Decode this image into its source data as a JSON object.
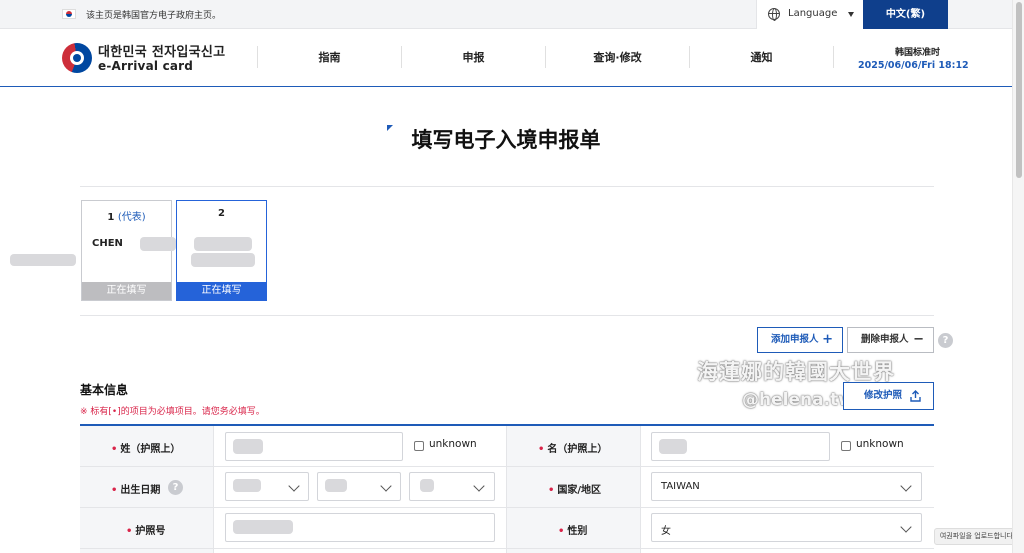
{
  "topbar": {
    "notice": "该主页是韩国官方电子政府主页。",
    "language_label": "Language",
    "current_language": "中文(繁)"
  },
  "header": {
    "logo_kr": "대한민국 전자입국신고",
    "logo_en": "e-Arrival card",
    "nav": [
      "指南",
      "申报",
      "查询·修改",
      "通知"
    ],
    "time_label": "韩国标准时",
    "time_value": "2025/06/06/Fri 18:12"
  },
  "page": {
    "title": "填写电子入境申报单"
  },
  "applicants": [
    {
      "number": "1",
      "rep_label": "(代表)",
      "name": "CHEN",
      "status": "正在填写"
    },
    {
      "number": "2",
      "rep_label": "",
      "name": "",
      "status": "正在填写"
    }
  ],
  "actions": {
    "add_label": "添加申报人",
    "add_symbol": "+",
    "delete_label": "删除申报人",
    "delete_symbol": "−",
    "help_symbol": "?",
    "edit_passport_label": "修改护照"
  },
  "section": {
    "title": "基本信息",
    "required_note": "※ 标有[•]的项目为必填项目。请您务必填写。"
  },
  "form": {
    "required_mark": "•",
    "surname_label": "姓（护照上）",
    "given_name_label": "名（护照上）",
    "unknown_label": "unknown",
    "dob_label": "出生日期",
    "country_label": "国家/地区",
    "country_value": "TAIWAN",
    "passport_label": "护照号",
    "gender_label": "性别",
    "gender_value": "女"
  },
  "watermark": {
    "line1": "海蓮娜的韓國大世界",
    "line2": "@helena.tw"
  },
  "toast": "여권파일을 업로드합니다.",
  "colors": {
    "brand_blue": "#1e5bb8",
    "lang_button": "#0f3f8c",
    "active_blue": "#2563d9",
    "required_red": "#d9254a"
  }
}
